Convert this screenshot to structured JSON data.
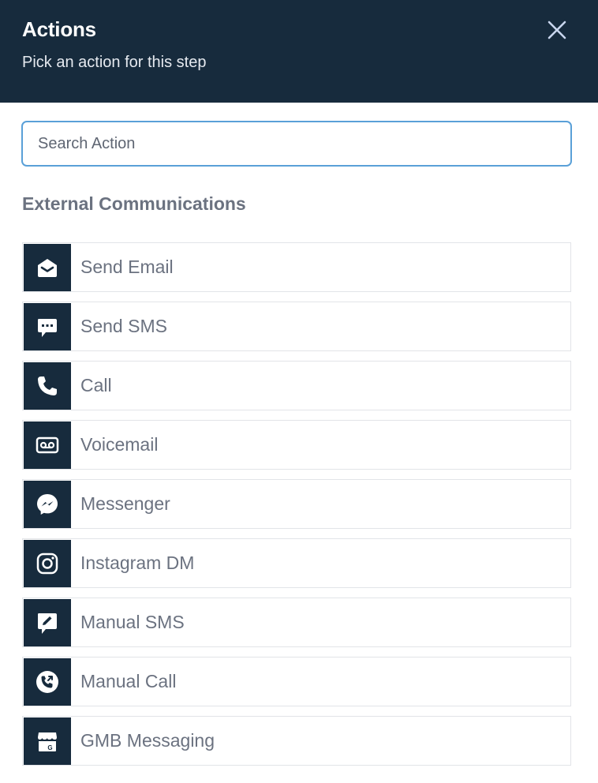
{
  "header": {
    "title": "Actions",
    "subtitle": "Pick an action for this step",
    "close_icon": "close-icon"
  },
  "search": {
    "placeholder": "Search Action",
    "value": ""
  },
  "section": {
    "title": "External Communications"
  },
  "actions": [
    {
      "label": "Send Email",
      "icon": "envelope-open-icon"
    },
    {
      "label": "Send SMS",
      "icon": "chat-dots-icon"
    },
    {
      "label": "Call",
      "icon": "phone-icon"
    },
    {
      "label": "Voicemail",
      "icon": "voicemail-icon"
    },
    {
      "label": "Messenger",
      "icon": "messenger-icon"
    },
    {
      "label": "Instagram DM",
      "icon": "instagram-icon"
    },
    {
      "label": "Manual SMS",
      "icon": "chat-pencil-icon"
    },
    {
      "label": "Manual Call",
      "icon": "phone-outgoing-icon"
    },
    {
      "label": "GMB Messaging",
      "icon": "storefront-icon"
    }
  ],
  "colors": {
    "header_bg": "#172b3d",
    "icon_bg": "#172b3d",
    "focus_border": "#5aa0d8",
    "label_text": "#6b7280"
  }
}
